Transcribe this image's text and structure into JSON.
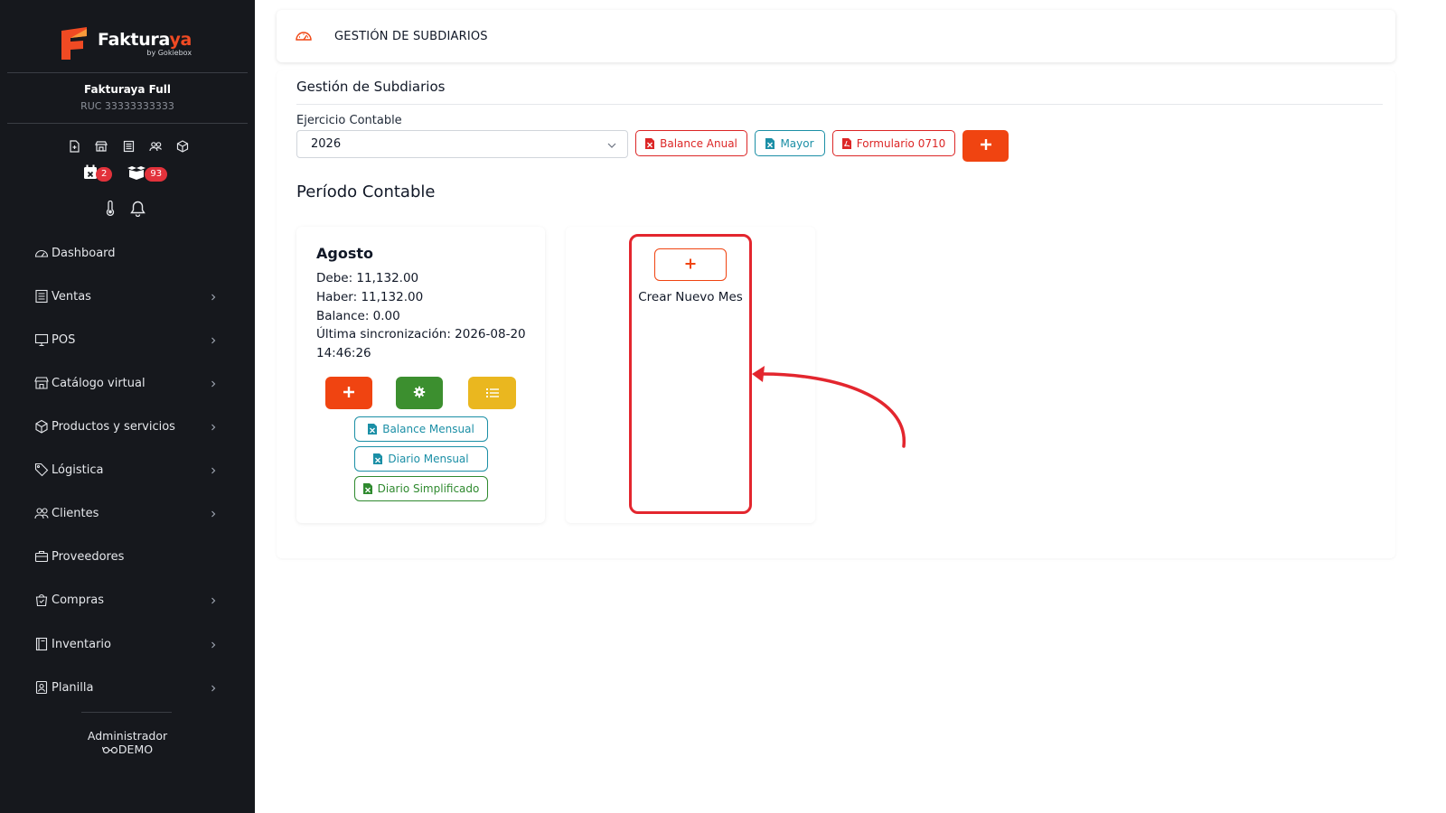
{
  "brand": {
    "name_main": "Faktura",
    "name_accent": "ya",
    "by": "by Gokiebox"
  },
  "company": {
    "name": "Fakturaya Full",
    "ruc": "RUC 33333333333"
  },
  "badges": {
    "calendar_count": "2",
    "boxes_count": "93"
  },
  "nav": [
    {
      "label": "Dashboard",
      "icon": "speedometer-icon",
      "chevron": false
    },
    {
      "label": "Ventas",
      "icon": "receipt-icon",
      "chevron": true
    },
    {
      "label": "POS",
      "icon": "monitor-icon",
      "chevron": true
    },
    {
      "label": "Catálogo virtual",
      "icon": "store-icon",
      "chevron": true
    },
    {
      "label": "Productos y servicios",
      "icon": "box-icon",
      "chevron": true
    },
    {
      "label": "Lógistica",
      "icon": "tag-icon",
      "chevron": true
    },
    {
      "label": "Clientes",
      "icon": "users-icon",
      "chevron": true
    },
    {
      "label": "Proveedores",
      "icon": "briefcase-icon",
      "chevron": false
    },
    {
      "label": "Compras",
      "icon": "bag-icon",
      "chevron": true
    },
    {
      "label": "Inventario",
      "icon": "book-icon",
      "chevron": true
    },
    {
      "label": "Planilla",
      "icon": "badge-icon",
      "chevron": true
    }
  ],
  "user": {
    "role": "Administrador",
    "name": "DEMO"
  },
  "header": {
    "title": "GESTIÓN DE SUBDIARIOS"
  },
  "page": {
    "title": "Gestión de Subdiarios",
    "ejercicio_label": "Ejercicio Contable",
    "ejercicio_value": "2026",
    "btn_balance_anual": "Balance Anual",
    "btn_mayor": "Mayor",
    "btn_formulario": "Formulario 0710",
    "periodo_title": "Período Contable"
  },
  "month_card": {
    "title": "Agosto",
    "debe": "Debe: 11,132.00",
    "haber": "Haber: 11,132.00",
    "balance": "Balance: 0.00",
    "sync_line1": "Última sincronización: 2026-08-20",
    "sync_line2": "14:46:26",
    "btn_balance_mensual": "Balance Mensual",
    "btn_diario_mensual": "Diario Mensual",
    "btn_diario_simplificado": "Diario Simplificado"
  },
  "new_month": {
    "label": "Crear Nuevo Mes"
  },
  "colors": {
    "accent": "#f04411",
    "sidebar": "#16181d",
    "highlight": "#e3262e",
    "teal": "#1b8fa6",
    "green": "#2f8a2f"
  }
}
